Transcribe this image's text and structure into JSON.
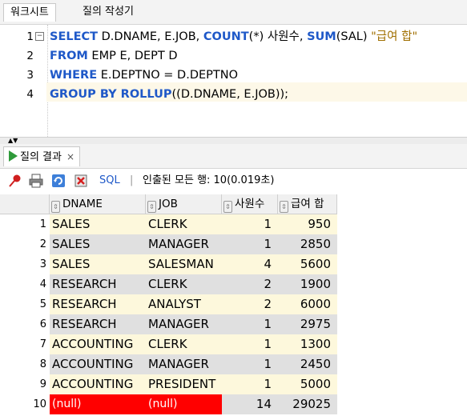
{
  "tabs": {
    "worksheet": "워크시트",
    "query_builder": "질의 작성기"
  },
  "editor": {
    "lines": [
      {
        "num": "1",
        "has_fold": true
      },
      {
        "num": "2"
      },
      {
        "num": "3"
      },
      {
        "num": "4"
      }
    ],
    "line1": {
      "kw1": "SELECT",
      "t1": " D.DNAME, E.JOB, ",
      "kw2": "COUNT",
      "t2": "(*) 사원수, ",
      "kw3": "SUM",
      "t3": "(SAL) ",
      "s1": "\"급여 합\""
    },
    "line2": {
      "kw1": "FROM",
      "t1": " EMP E, DEPT D"
    },
    "line3": {
      "kw1": "WHERE",
      "t1": " E.DEPTNO = D.DEPTNO"
    },
    "line4": {
      "kw1": "GROUP BY ROLLUP",
      "t1": "((D.DNAME, E.JOB));"
    }
  },
  "results": {
    "tab_label": "질의 결과",
    "close_label": "×",
    "sql_label": "SQL",
    "separator": "|",
    "status": "인출된 모든 행: 10(0.019초)",
    "columns": [
      "DNAME",
      "JOB",
      "사원수",
      "급여 합"
    ],
    "rows": [
      {
        "n": "1",
        "dname": "SALES",
        "job": "CLERK",
        "cnt": "1",
        "sum": "950"
      },
      {
        "n": "2",
        "dname": "SALES",
        "job": "MANAGER",
        "cnt": "1",
        "sum": "2850"
      },
      {
        "n": "3",
        "dname": "SALES",
        "job": "SALESMAN",
        "cnt": "4",
        "sum": "5600"
      },
      {
        "n": "4",
        "dname": "RESEARCH",
        "job": "CLERK",
        "cnt": "2",
        "sum": "1900"
      },
      {
        "n": "5",
        "dname": "RESEARCH",
        "job": "ANALYST",
        "cnt": "2",
        "sum": "6000"
      },
      {
        "n": "6",
        "dname": "RESEARCH",
        "job": "MANAGER",
        "cnt": "1",
        "sum": "2975"
      },
      {
        "n": "7",
        "dname": "ACCOUNTING",
        "job": "CLERK",
        "cnt": "1",
        "sum": "1300"
      },
      {
        "n": "8",
        "dname": "ACCOUNTING",
        "job": "MANAGER",
        "cnt": "1",
        "sum": "2450"
      },
      {
        "n": "9",
        "dname": "ACCOUNTING",
        "job": "PRESIDENT",
        "cnt": "1",
        "sum": "5000"
      },
      {
        "n": "10",
        "dname": "(null)",
        "job": "(null)",
        "cnt": "14",
        "sum": "29025"
      }
    ]
  },
  "colors": {
    "keyword": "#1e58c8",
    "odd_row": "#fdf8dc",
    "even_row": "#e0e0e0",
    "null_bg": "#ff0000"
  },
  "icons": [
    "pin-icon",
    "print-icon",
    "refresh-sql-icon",
    "export-icon",
    "play-icon"
  ]
}
